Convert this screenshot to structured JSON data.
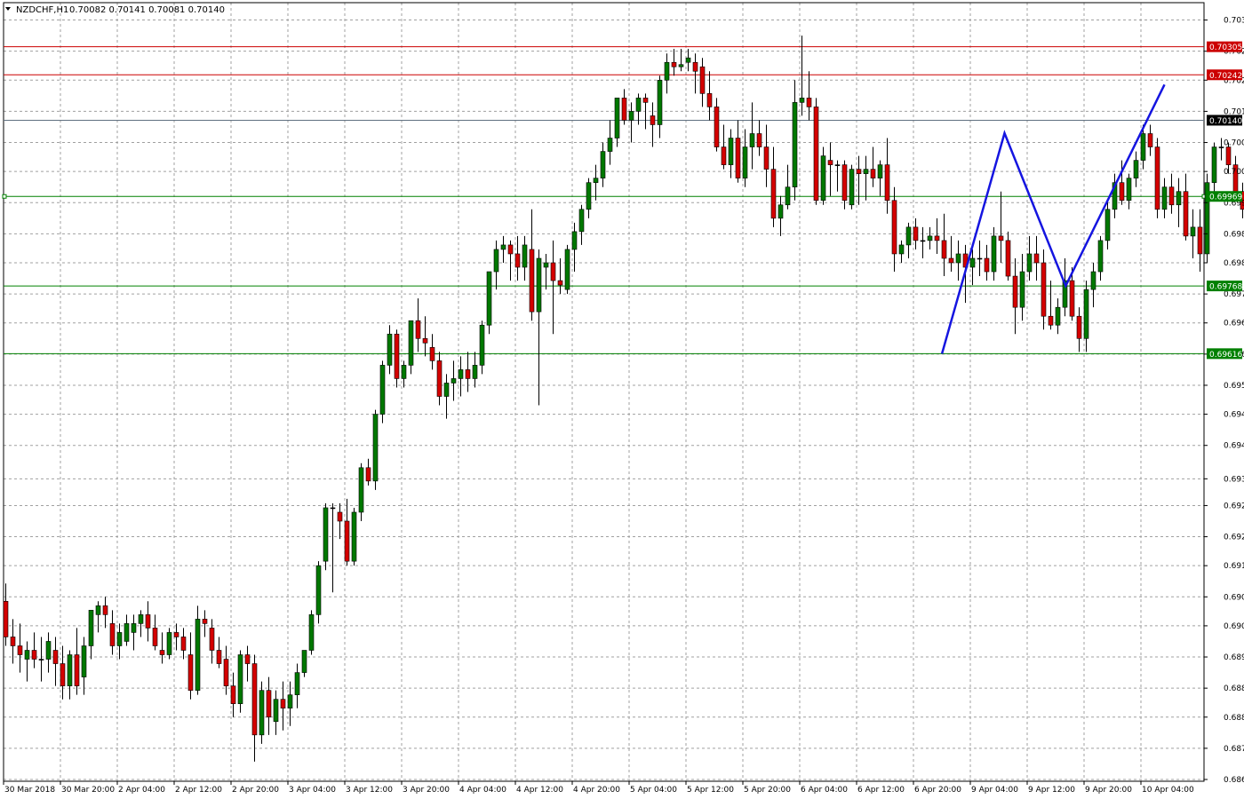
{
  "header": {
    "symbol": "NZDCHF,H1",
    "ohlc": "0.70082 0.70141 0.70081 0.70140"
  },
  "colors": {
    "background": "#ffffff",
    "grid": "#a0a0a0",
    "bull": "#007800",
    "bear": "#d40000",
    "wick": "#000000",
    "resistance": "#cc0000",
    "support": "#008000",
    "current": "#607080",
    "pattern": "#1515e0"
  },
  "chart_data": {
    "type": "candlestick",
    "title": "",
    "ylim": [
      0.6866,
      0.704
    ],
    "y_ticks": [
      "0.70365",
      "0.70295",
      "0.70230",
      "0.70160",
      "0.70090",
      "0.70025",
      "0.69955",
      "0.69885",
      "0.69820",
      "0.69750",
      "0.69685",
      "0.69615",
      "0.69545",
      "0.69480",
      "0.69410",
      "0.69335",
      "0.69275",
      "0.69205",
      "0.69140",
      "0.69070",
      "0.69005",
      "0.68935",
      "0.68865",
      "0.68800",
      "0.68730",
      "0.68660"
    ],
    "x_ticks": [
      {
        "label": "30 Mar 2018",
        "bar": 0
      },
      {
        "label": "30 Mar 20:00",
        "bar": 8
      },
      {
        "label": "2 Apr 04:00",
        "bar": 16
      },
      {
        "label": "2 Apr 12:00",
        "bar": 24
      },
      {
        "label": "2 Apr 20:00",
        "bar": 32
      },
      {
        "label": "3 Apr 04:00",
        "bar": 40
      },
      {
        "label": "3 Apr 12:00",
        "bar": 48
      },
      {
        "label": "3 Apr 20:00",
        "bar": 56
      },
      {
        "label": "4 Apr 04:00",
        "bar": 64
      },
      {
        "label": "4 Apr 12:00",
        "bar": 72
      },
      {
        "label": "4 Apr 20:00",
        "bar": 80
      },
      {
        "label": "5 Apr 04:00",
        "bar": 88
      },
      {
        "label": "5 Apr 12:00",
        "bar": 96
      },
      {
        "label": "5 Apr 20:00",
        "bar": 104
      },
      {
        "label": "6 Apr 04:00",
        "bar": 112
      },
      {
        "label": "6 Apr 12:00",
        "bar": 120
      },
      {
        "label": "6 Apr 20:00",
        "bar": 128
      },
      {
        "label": "9 Apr 04:00",
        "bar": 136
      },
      {
        "label": "9 Apr 12:00",
        "bar": 144
      },
      {
        "label": "9 Apr 20:00",
        "bar": 152
      },
      {
        "label": "10 Apr 04:00",
        "bar": 160
      }
    ],
    "levels": [
      {
        "value": 0.70305,
        "label": "0.70305",
        "kind": "resistance"
      },
      {
        "value": 0.70242,
        "label": "0.70242",
        "kind": "resistance"
      },
      {
        "value": 0.7014,
        "label": "0.70140",
        "kind": "current"
      },
      {
        "value": 0.69969,
        "label": "0.69969",
        "kind": "support"
      },
      {
        "value": 0.69768,
        "label": "0.69768",
        "kind": "support"
      },
      {
        "value": 0.69616,
        "label": "0.69616",
        "kind": "support"
      }
    ],
    "pattern": [
      {
        "bar": 131.7,
        "price": 0.69616
      },
      {
        "bar": 140.5,
        "price": 0.70111
      },
      {
        "bar": 149.1,
        "price": 0.69768
      },
      {
        "bar": 163,
        "price": 0.7022
      }
    ],
    "candles": [
      [
        0.6906,
        0.691,
        0.6896,
        0.6898
      ],
      [
        0.6898,
        0.6902,
        0.6892,
        0.6896
      ],
      [
        0.6896,
        0.6901,
        0.689,
        0.6894
      ],
      [
        0.6893,
        0.6897,
        0.6888,
        0.6895
      ],
      [
        0.6895,
        0.6899,
        0.6891,
        0.6893
      ],
      [
        0.6893,
        0.6898,
        0.6888,
        0.6893
      ],
      [
        0.6893,
        0.6899,
        0.689,
        0.6897
      ],
      [
        0.6895,
        0.6898,
        0.6887,
        0.6892
      ],
      [
        0.6892,
        0.6896,
        0.6884,
        0.6887
      ],
      [
        0.6887,
        0.6895,
        0.6884,
        0.6894
      ],
      [
        0.6894,
        0.69,
        0.6885,
        0.6887
      ],
      [
        0.6889,
        0.6898,
        0.6885,
        0.6896
      ],
      [
        0.6896,
        0.6904,
        0.6893,
        0.6904
      ],
      [
        0.6903,
        0.6906,
        0.6899,
        0.6905
      ],
      [
        0.6905,
        0.6907,
        0.69,
        0.6903
      ],
      [
        0.6901,
        0.6904,
        0.6894,
        0.6896
      ],
      [
        0.6896,
        0.6901,
        0.6893,
        0.6899
      ],
      [
        0.6897,
        0.6903,
        0.6896,
        0.6901
      ],
      [
        0.6899,
        0.6903,
        0.6895,
        0.6901
      ],
      [
        0.6901,
        0.6904,
        0.6898,
        0.6903
      ],
      [
        0.6903,
        0.6906,
        0.6897,
        0.69
      ],
      [
        0.69,
        0.6903,
        0.6895,
        0.6896
      ],
      [
        0.6895,
        0.6899,
        0.6892,
        0.6894
      ],
      [
        0.6894,
        0.69,
        0.6893,
        0.6899
      ],
      [
        0.6899,
        0.6901,
        0.6895,
        0.6898
      ],
      [
        0.6898,
        0.69,
        0.6893,
        0.6895
      ],
      [
        0.6894,
        0.6899,
        0.6884,
        0.6886
      ],
      [
        0.6886,
        0.6905,
        0.6885,
        0.6902
      ],
      [
        0.6902,
        0.6904,
        0.6898,
        0.6901
      ],
      [
        0.69,
        0.6902,
        0.6892,
        0.6895
      ],
      [
        0.6895,
        0.6898,
        0.6891,
        0.6892
      ],
      [
        0.6893,
        0.6896,
        0.6885,
        0.6887
      ],
      [
        0.6887,
        0.689,
        0.688,
        0.6883
      ],
      [
        0.6883,
        0.6895,
        0.6881,
        0.6894
      ],
      [
        0.6894,
        0.6896,
        0.6888,
        0.6892
      ],
      [
        0.6892,
        0.6894,
        0.687,
        0.6876
      ],
      [
        0.6876,
        0.6888,
        0.6874,
        0.6886
      ],
      [
        0.6886,
        0.6889,
        0.6876,
        0.688
      ],
      [
        0.6879,
        0.6886,
        0.6876,
        0.6884
      ],
      [
        0.6884,
        0.6888,
        0.6877,
        0.6882
      ],
      [
        0.6882,
        0.6888,
        0.6878,
        0.6885
      ],
      [
        0.6885,
        0.6892,
        0.6882,
        0.689
      ],
      [
        0.689,
        0.6895,
        0.6889,
        0.6895
      ],
      [
        0.6895,
        0.6904,
        0.6894,
        0.6903
      ],
      [
        0.6903,
        0.6915,
        0.6901,
        0.6914
      ],
      [
        0.6915,
        0.6928,
        0.6913,
        0.6927
      ],
      [
        0.6927,
        0.6928,
        0.6908,
        0.6927
      ],
      [
        0.6926,
        0.6928,
        0.692,
        0.6924
      ],
      [
        0.6924,
        0.6929,
        0.6914,
        0.6915
      ],
      [
        0.6915,
        0.6927,
        0.6914,
        0.6926
      ],
      [
        0.6926,
        0.6937,
        0.6924,
        0.6936
      ],
      [
        0.6936,
        0.6938,
        0.6932,
        0.6933
      ],
      [
        0.6933,
        0.6949,
        0.6931,
        0.6948
      ],
      [
        0.6948,
        0.696,
        0.6946,
        0.6959
      ],
      [
        0.6959,
        0.6968,
        0.6957,
        0.6966
      ],
      [
        0.6966,
        0.6967,
        0.6954,
        0.6956
      ],
      [
        0.6956,
        0.696,
        0.6954,
        0.6959
      ],
      [
        0.6959,
        0.6969,
        0.6957,
        0.6969
      ],
      [
        0.6969,
        0.6974,
        0.6962,
        0.6965
      ],
      [
        0.6965,
        0.697,
        0.6961,
        0.6964
      ],
      [
        0.6963,
        0.6966,
        0.6958,
        0.696
      ],
      [
        0.696,
        0.6962,
        0.695,
        0.6952
      ],
      [
        0.6952,
        0.6957,
        0.6947,
        0.6955
      ],
      [
        0.6955,
        0.696,
        0.6951,
        0.6956
      ],
      [
        0.6956,
        0.6961,
        0.6952,
        0.6958
      ],
      [
        0.6958,
        0.6962,
        0.6953,
        0.6956
      ],
      [
        0.6956,
        0.6962,
        0.6954,
        0.6959
      ],
      [
        0.6959,
        0.6969,
        0.6957,
        0.6968
      ],
      [
        0.6968,
        0.698,
        0.6966,
        0.698
      ],
      [
        0.698,
        0.6987,
        0.6976,
        0.6985
      ],
      [
        0.6985,
        0.6988,
        0.6982,
        0.6986
      ],
      [
        0.6986,
        0.6987,
        0.6978,
        0.6984
      ],
      [
        0.6984,
        0.6988,
        0.6978,
        0.6981
      ],
      [
        0.6981,
        0.6988,
        0.6978,
        0.6986
      ],
      [
        0.6985,
        0.6994,
        0.6969,
        0.6971
      ],
      [
        0.6971,
        0.6985,
        0.695,
        0.6983
      ],
      [
        0.6981,
        0.6984,
        0.6976,
        0.6982
      ],
      [
        0.6982,
        0.6987,
        0.6966,
        0.6978
      ],
      [
        0.6978,
        0.6983,
        0.6975,
        0.6977
      ],
      [
        0.6976,
        0.6986,
        0.6975,
        0.6985
      ],
      [
        0.6985,
        0.6991,
        0.698,
        0.6989
      ],
      [
        0.6989,
        0.6995,
        0.6986,
        0.6994
      ],
      [
        0.6994,
        0.7001,
        0.6992,
        0.7
      ],
      [
        0.7,
        0.7004,
        0.6996,
        0.7001
      ],
      [
        0.7001,
        0.7009,
        0.6999,
        0.7007
      ],
      [
        0.7007,
        0.7014,
        0.7004,
        0.701
      ],
      [
        0.701,
        0.7017,
        0.7008,
        0.7019
      ],
      [
        0.7019,
        0.7021,
        0.7013,
        0.7014
      ],
      [
        0.7014,
        0.7018,
        0.7009,
        0.7016
      ],
      [
        0.7016,
        0.702,
        0.7013,
        0.7019
      ],
      [
        0.7019,
        0.702,
        0.7012,
        0.7018
      ],
      [
        0.7015,
        0.7018,
        0.7008,
        0.7013
      ],
      [
        0.7013,
        0.7024,
        0.701,
        0.7023
      ],
      [
        0.7023,
        0.7029,
        0.702,
        0.7027
      ],
      [
        0.7027,
        0.703,
        0.7024,
        0.7026
      ],
      [
        0.7026,
        0.703,
        0.7025,
        0.70265
      ],
      [
        0.7027,
        0.703,
        0.7025,
        0.7028
      ],
      [
        0.7027,
        0.7029,
        0.702,
        0.7025
      ],
      [
        0.7026,
        0.7028,
        0.7017,
        0.702
      ],
      [
        0.702,
        0.7025,
        0.7014,
        0.7017
      ],
      [
        0.7017,
        0.7019,
        0.7007,
        0.7008
      ],
      [
        0.7008,
        0.7013,
        0.7003,
        0.7004
      ],
      [
        0.7004,
        0.7012,
        0.7001,
        0.701
      ],
      [
        0.701,
        0.7014,
        0.7,
        0.7001
      ],
      [
        0.7001,
        0.7012,
        0.6999,
        0.7008
      ],
      [
        0.7008,
        0.7018,
        0.7003,
        0.7011
      ],
      [
        0.7011,
        0.7014,
        0.7006,
        0.7008
      ],
      [
        0.7008,
        0.7013,
        0.6999,
        0.7003
      ],
      [
        0.7003,
        0.7008,
        0.699,
        0.6992
      ],
      [
        0.6992,
        0.6997,
        0.6988,
        0.6995
      ],
      [
        0.6995,
        0.7004,
        0.6994,
        0.6999
      ],
      [
        0.6999,
        0.7023,
        0.6996,
        0.7018
      ],
      [
        0.7018,
        0.7033,
        0.7015,
        0.7019
      ],
      [
        0.7019,
        0.7025,
        0.7014,
        0.7017
      ],
      [
        0.7017,
        0.7019,
        0.6995,
        0.6996
      ],
      [
        0.6996,
        0.7008,
        0.6995,
        0.7006
      ],
      [
        0.7005,
        0.7009,
        0.6997,
        0.7004
      ],
      [
        0.7004,
        0.7005,
        0.6998,
        0.7004
      ],
      [
        0.7004,
        0.7005,
        0.6994,
        0.6996
      ],
      [
        0.6995,
        0.7004,
        0.6994,
        0.7003
      ],
      [
        0.7003,
        0.7006,
        0.6995,
        0.7002
      ],
      [
        0.7002,
        0.7006,
        0.6996,
        0.7003
      ],
      [
        0.7003,
        0.7008,
        0.6999,
        0.7001
      ],
      [
        0.7001,
        0.7005,
        0.6997,
        0.7004
      ],
      [
        0.7004,
        0.701,
        0.6993,
        0.6996
      ],
      [
        0.6996,
        0.6999,
        0.698,
        0.6984
      ],
      [
        0.6984,
        0.6987,
        0.6982,
        0.6986
      ],
      [
        0.6986,
        0.6991,
        0.6983,
        0.699
      ],
      [
        0.699,
        0.6992,
        0.6985,
        0.6987
      ],
      [
        0.6987,
        0.699,
        0.6983,
        0.6987
      ],
      [
        0.6987,
        0.699,
        0.6985,
        0.6988
      ],
      [
        0.6988,
        0.6992,
        0.6984,
        0.6987
      ],
      [
        0.6987,
        0.6993,
        0.6979,
        0.6983
      ],
      [
        0.6983,
        0.6988,
        0.698,
        0.6982
      ],
      [
        0.6982,
        0.6987,
        0.6978,
        0.6984
      ],
      [
        0.6984,
        0.6986,
        0.6973,
        0.6981
      ],
      [
        0.6981,
        0.6985,
        0.6977,
        0.6983
      ],
      [
        0.6983,
        0.6987,
        0.6979,
        0.6983
      ],
      [
        0.6983,
        0.6986,
        0.6978,
        0.698
      ],
      [
        0.698,
        0.699,
        0.6978,
        0.6988
      ],
      [
        0.6988,
        0.6998,
        0.6982,
        0.6987
      ],
      [
        0.6987,
        0.6989,
        0.6978,
        0.6979
      ],
      [
        0.6979,
        0.6983,
        0.6966,
        0.6972
      ],
      [
        0.6972,
        0.6984,
        0.6969,
        0.698
      ],
      [
        0.698,
        0.6988,
        0.6978,
        0.6984
      ],
      [
        0.6984,
        0.6988,
        0.6978,
        0.6982
      ],
      [
        0.6982,
        0.6985,
        0.6967,
        0.697
      ],
      [
        0.697,
        0.6978,
        0.6967,
        0.6968
      ],
      [
        0.6968,
        0.6974,
        0.6966,
        0.6972
      ],
      [
        0.6972,
        0.6983,
        0.697,
        0.6978
      ],
      [
        0.6978,
        0.6981,
        0.6969,
        0.697
      ],
      [
        0.697,
        0.6972,
        0.6962,
        0.6965
      ],
      [
        0.6965,
        0.6978,
        0.6962,
        0.6976
      ],
      [
        0.6976,
        0.6982,
        0.6972,
        0.698
      ],
      [
        0.698,
        0.6988,
        0.6978,
        0.6987
      ],
      [
        0.6987,
        0.6996,
        0.6985,
        0.6994
      ],
      [
        0.6994,
        0.7002,
        0.6992,
        0.7
      ],
      [
        0.7,
        0.7005,
        0.6995,
        0.6996
      ],
      [
        0.6996,
        0.7002,
        0.6994,
        0.7001
      ],
      [
        0.7001,
        0.7007,
        0.6999,
        0.7005
      ],
      [
        0.7005,
        0.7013,
        0.7003,
        0.7011
      ],
      [
        0.7011,
        0.7013,
        0.7006,
        0.7008
      ],
      [
        0.7008,
        0.701,
        0.6992,
        0.6994
      ],
      [
        0.6994,
        0.7001,
        0.6992,
        0.6999
      ],
      [
        0.6999,
        0.7002,
        0.6993,
        0.6995
      ],
      [
        0.6995,
        0.7001,
        0.699,
        0.6998
      ],
      [
        0.6998,
        0.7002,
        0.6987,
        0.6988
      ],
      [
        0.6988,
        0.6994,
        0.6983,
        0.699
      ],
      [
        0.699,
        0.6994,
        0.698,
        0.6984
      ],
      [
        0.6984,
        0.7002,
        0.6982,
        0.7
      ],
      [
        0.7,
        0.7009,
        0.6998,
        0.7008
      ],
      [
        0.7008,
        0.701,
        0.7005,
        0.7008
      ],
      [
        0.7008,
        0.7009,
        0.7002,
        0.7004
      ],
      [
        0.7004,
        0.7006,
        0.6996,
        0.6998
      ],
      [
        0.6998,
        0.7,
        0.6992,
        0.6994
      ],
      [
        0.6994,
        0.6996,
        0.6985,
        0.6988
      ],
      [
        0.6988,
        0.6992,
        0.6983,
        0.6986
      ],
      [
        0.6986,
        0.6988,
        0.6981,
        0.6983
      ],
      [
        0.6983,
        0.6988,
        0.6982,
        0.6986
      ],
      [
        0.6986,
        0.6988,
        0.6981,
        0.6983
      ],
      [
        0.6983,
        0.6987,
        0.6982,
        0.6985
      ],
      [
        0.6985,
        0.6991,
        0.6984,
        0.6989
      ],
      [
        0.6989,
        0.6996,
        0.6987,
        0.6995
      ],
      [
        0.6995,
        0.7006,
        0.6992,
        0.7004
      ],
      [
        0.7004,
        0.7014,
        0.7003,
        0.7013
      ],
      [
        0.7013,
        0.7015,
        0.7006,
        0.7008
      ],
      [
        0.7008,
        0.70141,
        0.7008,
        0.7014
      ]
    ]
  }
}
